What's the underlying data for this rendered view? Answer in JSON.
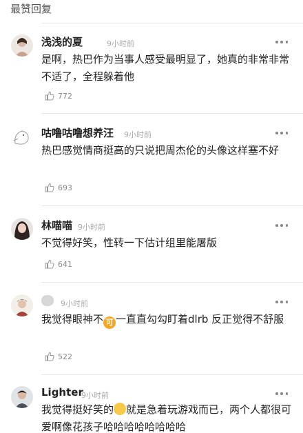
{
  "section": {
    "title": "最赞回复"
  },
  "comments": [
    {
      "user": "浅浅的夏",
      "time": "9小时前",
      "text": "是啊，热巴作为当事人感受最明显了，她真的非常非常不适了，全程躲着他",
      "likes": "772"
    },
    {
      "user": "咕噜咕噜想养汪",
      "time": "9小时前",
      "text": "热巴感觉情商挺高的只说把周杰伦的头像这样塞不好",
      "likes": "693"
    },
    {
      "user": "林喵喵",
      "time": "9小时前",
      "text": "不觉得好笑，性转一下估计组里能屠版",
      "likes": "641"
    },
    {
      "user": "",
      "time": "9小时前",
      "text_a": "我觉得眼神不",
      "emoji_text": "可",
      "text_b": "一直直勾勾盯着dlrb 反正觉得不舒服",
      "likes": "522"
    },
    {
      "user": "Lighter",
      "time": "9小时前",
      "text_a": "我觉得挺好笑的",
      "text_b": "就是急着玩游戏而已，两个人都很可爱啊像花孩子哈哈哈哈哈哈哈哈"
    }
  ],
  "icons": {
    "like": "thumbs-up-icon",
    "more": "more-dots-icon"
  }
}
